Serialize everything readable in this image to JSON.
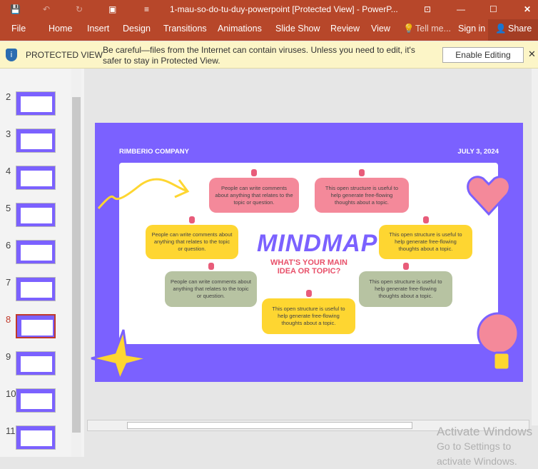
{
  "titlebar": {
    "title": "1-mau-so-do-tu-duy-powerpoint [Protected View] - PowerP..."
  },
  "ribbon": {
    "tabs": [
      "File",
      "Home",
      "Insert",
      "Design",
      "Transitions",
      "Animations",
      "Slide Show",
      "Review",
      "View"
    ],
    "tell_me": "Tell me...",
    "sign_in": "Sign in",
    "share": "Share"
  },
  "protected": {
    "label": "PROTECTED VIEW",
    "message": "Be careful—files from the Internet can contain viruses. Unless you need to edit, it's safer to stay in Protected View.",
    "button": "Enable Editing"
  },
  "thumbnails": {
    "numbers": [
      "2",
      "3",
      "4",
      "5",
      "6",
      "7",
      "8",
      "9",
      "10",
      "11"
    ],
    "selected": "8"
  },
  "slide": {
    "company": "RIMBERIO COMPANY",
    "date": "JULY 3, 2024",
    "title": "MINDMAP",
    "subtitle": "WHAT'S YOUR MAIN IDEA OR TOPIC?",
    "notes": [
      "People can write comments about anything that relates to the topic or question.",
      "This open structure is useful to help generate free-flowing thoughts about a topic.",
      "People can write comments about anything that relates to the topic or question.",
      "This open structure is useful to help generate free-flowing thoughts about a topic.",
      "People can write comments about anything that relates to the topic or question.",
      "This open structure is useful to help generate free-flowing thoughts about a topic.",
      "This open structure is useful to help generate free-flowing thoughts about a topic."
    ],
    "colors": {
      "frame": "#7b61ff",
      "pink": "#f4899a",
      "yellow": "#fed631",
      "green": "#b7c3a2"
    }
  },
  "watermark": {
    "line1": "Activate Windows",
    "line2": "Go to Settings to activate Windows."
  }
}
